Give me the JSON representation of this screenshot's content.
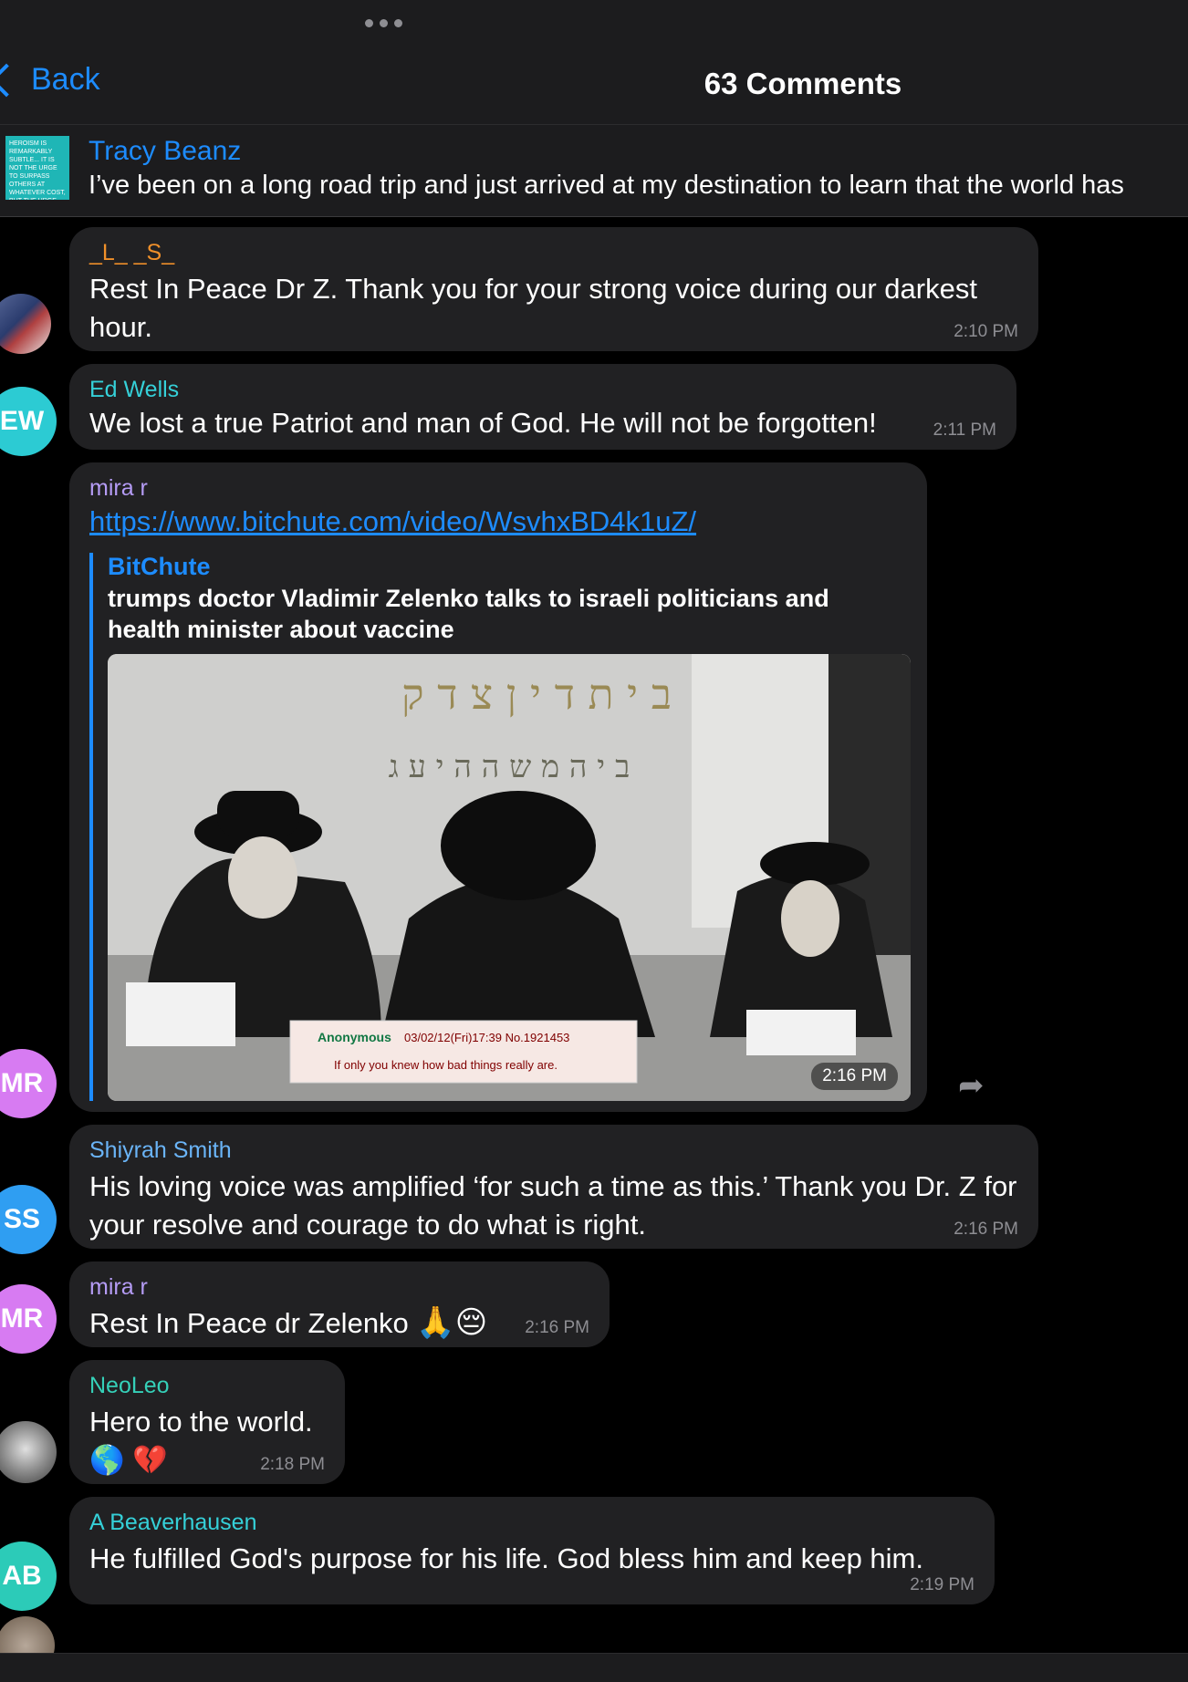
{
  "header": {
    "back_label": "Back",
    "title": "63 Comments"
  },
  "pinned": {
    "name": "Tracy Beanz",
    "text": "I’ve been on a long road trip and just arrived at my destination to learn that the world has",
    "thumb_text": "HEROISM IS REMARKABLY SUBTLE... IT IS NOT THE URGE TO SURPASS OTHERS AT WHATEVER COST, BUT THE URGE TO SERVE OTHERS AT WHATEVER COST."
  },
  "messages": [
    {
      "author": "_L_ _S_",
      "author_color": "#f0902a",
      "text": "Rest In Peace Dr Z. Thank you for your strong voice during our darkest hour.",
      "time": "2:10 PM",
      "avatar_initials": "",
      "avatar_color": "#3a4b74"
    },
    {
      "author": "Ed Wells",
      "author_color": "#35d0d8",
      "text": "We lost a true Patriot and man of God. He will not be forgotten!",
      "time": "2:11 PM",
      "avatar_initials": "EW",
      "avatar_color": "#2ccbd3"
    },
    {
      "author": "mira r",
      "author_color": "#b59cf5",
      "link": "https://www.bitchute.com/video/WsvhxBD4k1uZ/",
      "preview_site": "BitChute",
      "preview_title": "trumps doctor Vladimir Zelenko talks to israeli politicians and health minister about vaccine",
      "video_overlay_name": "Anonymous",
      "video_overlay_meta": "03/02/12(Fri)17:39 No.1921453",
      "video_overlay_text": "If only you knew how bad things really are.",
      "time": "2:16 PM",
      "avatar_initials": "MR",
      "avatar_color": "#d77bf2"
    },
    {
      "author": "Shiyrah Smith",
      "author_color": "#6ab4f7",
      "text": "His loving voice was amplified ‘for such a time as this.’ Thank you Dr. Z for your resolve and courage to do what is right.",
      "time": "2:16 PM",
      "avatar_initials": "SS",
      "avatar_color": "#2f9ef2"
    },
    {
      "author": "mira r",
      "author_color": "#b59cf5",
      "text": "Rest In Peace dr Zelenko",
      "emojis": "🙏😔",
      "time": "2:16 PM",
      "avatar_initials": "MR",
      "avatar_color": "#d77bf2"
    },
    {
      "author": "NeoLeo",
      "author_color": "#35d0b8",
      "text": "Hero to the world.",
      "emojis": "🌎 💔",
      "time": "2:18 PM",
      "avatar_initials": "",
      "avatar_color": "#9a9a9a"
    },
    {
      "author": "A Beaverhausen",
      "author_color": "#35d0d8",
      "text": "He fulfilled God's purpose for his life.  God bless him and keep him.",
      "time": "2:19 PM",
      "avatar_initials": "AB",
      "avatar_color": "#2ccbb8"
    }
  ],
  "colors": {
    "accent": "#1d8cff",
    "bubble": "#212123",
    "background": "#000000"
  }
}
